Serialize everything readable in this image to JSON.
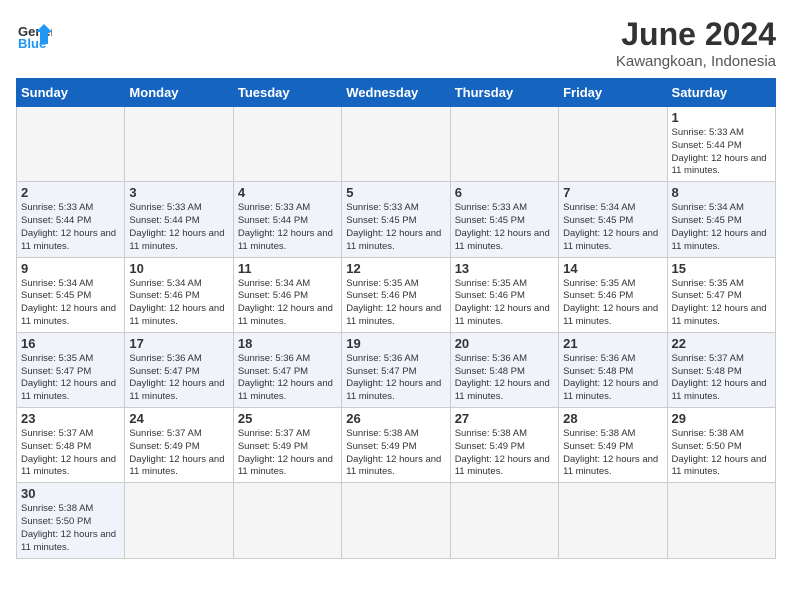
{
  "header": {
    "logo_general": "General",
    "logo_blue": "Blue",
    "title": "June 2024",
    "subtitle": "Kawangkoan, Indonesia"
  },
  "days_of_week": [
    "Sunday",
    "Monday",
    "Tuesday",
    "Wednesday",
    "Thursday",
    "Friday",
    "Saturday"
  ],
  "weeks": [
    [
      {
        "day": "",
        "info": ""
      },
      {
        "day": "",
        "info": ""
      },
      {
        "day": "",
        "info": ""
      },
      {
        "day": "",
        "info": ""
      },
      {
        "day": "",
        "info": ""
      },
      {
        "day": "",
        "info": ""
      },
      {
        "day": "1",
        "info": "Sunrise: 5:33 AM\nSunset: 5:44 PM\nDaylight: 12 hours and 11 minutes."
      }
    ],
    [
      {
        "day": "2",
        "info": "Sunrise: 5:33 AM\nSunset: 5:44 PM\nDaylight: 12 hours and 11 minutes."
      },
      {
        "day": "3",
        "info": "Sunrise: 5:33 AM\nSunset: 5:44 PM\nDaylight: 12 hours and 11 minutes."
      },
      {
        "day": "4",
        "info": "Sunrise: 5:33 AM\nSunset: 5:44 PM\nDaylight: 12 hours and 11 minutes."
      },
      {
        "day": "5",
        "info": "Sunrise: 5:33 AM\nSunset: 5:45 PM\nDaylight: 12 hours and 11 minutes."
      },
      {
        "day": "6",
        "info": "Sunrise: 5:33 AM\nSunset: 5:45 PM\nDaylight: 12 hours and 11 minutes."
      },
      {
        "day": "7",
        "info": "Sunrise: 5:34 AM\nSunset: 5:45 PM\nDaylight: 12 hours and 11 minutes."
      },
      {
        "day": "8",
        "info": "Sunrise: 5:34 AM\nSunset: 5:45 PM\nDaylight: 12 hours and 11 minutes."
      }
    ],
    [
      {
        "day": "9",
        "info": "Sunrise: 5:34 AM\nSunset: 5:45 PM\nDaylight: 12 hours and 11 minutes."
      },
      {
        "day": "10",
        "info": "Sunrise: 5:34 AM\nSunset: 5:46 PM\nDaylight: 12 hours and 11 minutes."
      },
      {
        "day": "11",
        "info": "Sunrise: 5:34 AM\nSunset: 5:46 PM\nDaylight: 12 hours and 11 minutes."
      },
      {
        "day": "12",
        "info": "Sunrise: 5:35 AM\nSunset: 5:46 PM\nDaylight: 12 hours and 11 minutes."
      },
      {
        "day": "13",
        "info": "Sunrise: 5:35 AM\nSunset: 5:46 PM\nDaylight: 12 hours and 11 minutes."
      },
      {
        "day": "14",
        "info": "Sunrise: 5:35 AM\nSunset: 5:46 PM\nDaylight: 12 hours and 11 minutes."
      },
      {
        "day": "15",
        "info": "Sunrise: 5:35 AM\nSunset: 5:47 PM\nDaylight: 12 hours and 11 minutes."
      }
    ],
    [
      {
        "day": "16",
        "info": "Sunrise: 5:35 AM\nSunset: 5:47 PM\nDaylight: 12 hours and 11 minutes."
      },
      {
        "day": "17",
        "info": "Sunrise: 5:36 AM\nSunset: 5:47 PM\nDaylight: 12 hours and 11 minutes."
      },
      {
        "day": "18",
        "info": "Sunrise: 5:36 AM\nSunset: 5:47 PM\nDaylight: 12 hours and 11 minutes."
      },
      {
        "day": "19",
        "info": "Sunrise: 5:36 AM\nSunset: 5:47 PM\nDaylight: 12 hours and 11 minutes."
      },
      {
        "day": "20",
        "info": "Sunrise: 5:36 AM\nSunset: 5:48 PM\nDaylight: 12 hours and 11 minutes."
      },
      {
        "day": "21",
        "info": "Sunrise: 5:36 AM\nSunset: 5:48 PM\nDaylight: 12 hours and 11 minutes."
      },
      {
        "day": "22",
        "info": "Sunrise: 5:37 AM\nSunset: 5:48 PM\nDaylight: 12 hours and 11 minutes."
      }
    ],
    [
      {
        "day": "23",
        "info": "Sunrise: 5:37 AM\nSunset: 5:48 PM\nDaylight: 12 hours and 11 minutes."
      },
      {
        "day": "24",
        "info": "Sunrise: 5:37 AM\nSunset: 5:49 PM\nDaylight: 12 hours and 11 minutes."
      },
      {
        "day": "25",
        "info": "Sunrise: 5:37 AM\nSunset: 5:49 PM\nDaylight: 12 hours and 11 minutes."
      },
      {
        "day": "26",
        "info": "Sunrise: 5:38 AM\nSunset: 5:49 PM\nDaylight: 12 hours and 11 minutes."
      },
      {
        "day": "27",
        "info": "Sunrise: 5:38 AM\nSunset: 5:49 PM\nDaylight: 12 hours and 11 minutes."
      },
      {
        "day": "28",
        "info": "Sunrise: 5:38 AM\nSunset: 5:49 PM\nDaylight: 12 hours and 11 minutes."
      },
      {
        "day": "29",
        "info": "Sunrise: 5:38 AM\nSunset: 5:50 PM\nDaylight: 12 hours and 11 minutes."
      }
    ],
    [
      {
        "day": "30",
        "info": "Sunrise: 5:38 AM\nSunset: 5:50 PM\nDaylight: 12 hours and 11 minutes."
      },
      {
        "day": "",
        "info": ""
      },
      {
        "day": "",
        "info": ""
      },
      {
        "day": "",
        "info": ""
      },
      {
        "day": "",
        "info": ""
      },
      {
        "day": "",
        "info": ""
      },
      {
        "day": "",
        "info": ""
      }
    ]
  ]
}
